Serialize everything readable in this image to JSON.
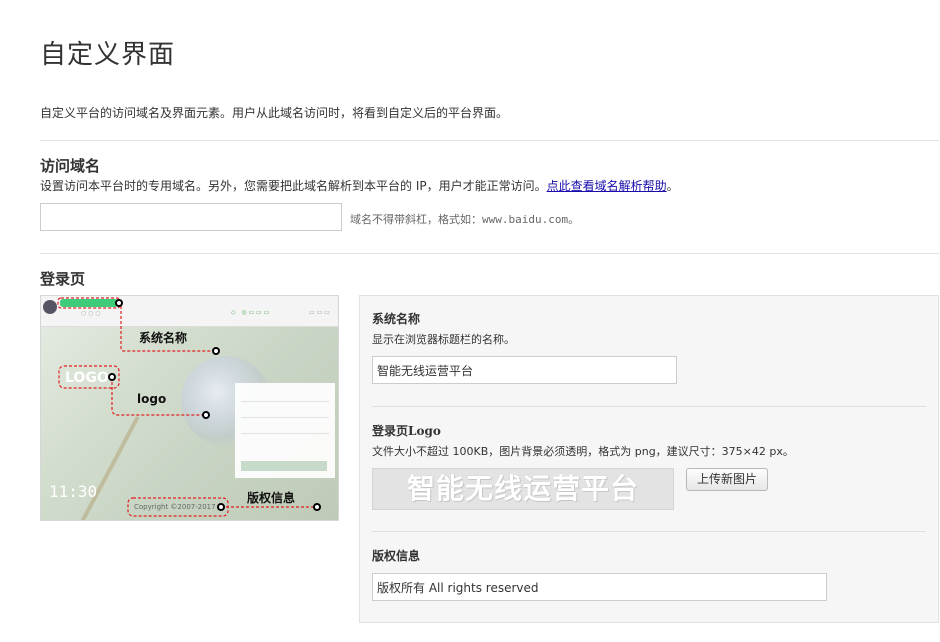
{
  "page": {
    "title": "自定义界面",
    "description": "自定义平台的访问域名及界面元素。用户从此域名访问时，将看到自定义后的平台界面。"
  },
  "domain_section": {
    "title": "访问域名",
    "description": "设置访问本平台时的专用域名。另外，您需要把此域名解析到本平台的 IP，用户才能正常访问。",
    "help_link": "点此查看域名解析帮助",
    "help_suffix": "。",
    "input_value": "",
    "hint": "域名不得带斜杠，格式如：www.baidu.com。"
  },
  "login_section": {
    "title": "登录页",
    "preview": {
      "callout_system_name": "系统名称",
      "callout_logo": "logo",
      "callout_copyright": "版权信息",
      "logo_placeholder": "LOGO",
      "copyright_text": "Copyright ©2007-2017",
      "clock": "11:30"
    },
    "system_name": {
      "title": "系统名称",
      "description": "显示在浏览器标题栏的名称。",
      "value": "智能无线运营平台"
    },
    "logo": {
      "title": "登录页Logo",
      "description": "文件大小不超过 100KB，图片背景必须透明，格式为 png，建议尺寸：375×42 px。",
      "preview_text": "智能无线运营平台",
      "upload_label": "上传新图片"
    },
    "copyright": {
      "title": "版权信息",
      "value": "版权所有 All rights reserved"
    }
  },
  "colors": {
    "accent_link": "#1a0dab",
    "callout_red": "#e02020",
    "preview_green": "#3ecb7a"
  }
}
